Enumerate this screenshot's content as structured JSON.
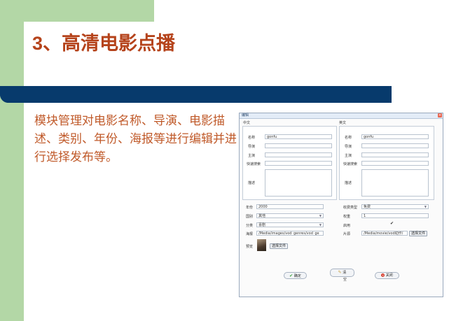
{
  "slide": {
    "title_num": "3",
    "title_text": "、高清电影点播",
    "bullet": "模块管理对电影名称、导演、电影描述、类别、年份、海报等进行编辑并进行选择发布等。"
  },
  "dialog": {
    "title": "编辑",
    "close_glyph": "×",
    "chinese_section": "中文",
    "english_section": "英文",
    "cn": {
      "name_label": "名称",
      "name_value": "gonfu",
      "director_label": "导演",
      "actor_label": "主演",
      "quicksearch_label": "快速搜索",
      "desc_label": "描述"
    },
    "en": {
      "name_label": "名称",
      "name_value": "gonfu",
      "director_label": "导演",
      "actor_label": "主演",
      "quicksearch_label": "快速搜索",
      "desc_label": "描述"
    },
    "year_label": "年份",
    "year_value": "2000",
    "country_label": "国别",
    "country_value": "其他",
    "category_label": "分类",
    "category_value": "喜剧",
    "poster_label": "海报",
    "poster_value": "/Media/images/vod_genres/vod_ge",
    "preview_label": "预览",
    "choose_file": "选择文件",
    "fee_label": "收费类型",
    "fee_value": "免费",
    "weight_label": "权重",
    "weight_value": "1",
    "enable_label": "启用",
    "enable_check": "✔",
    "film_label": "片源",
    "film_value": "/Media/movie/vod动作/",
    "choose_file2": "选择文件",
    "btn_ok": "确定",
    "btn_ok_icon": "✔",
    "btn_clear_top": "清",
    "btn_clear_bottom": "空",
    "btn_clear_icon": "✎",
    "btn_close": "关闭",
    "btn_close_icon": "×"
  }
}
